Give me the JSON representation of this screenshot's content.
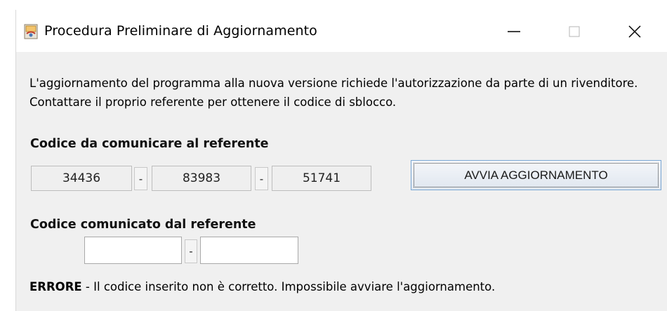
{
  "window": {
    "title": "Procedura Preliminare di Aggiornamento",
    "controls": {
      "minimize": "—",
      "maximize": "☐",
      "close": "✕"
    },
    "icon": "installer-app-icon"
  },
  "description": "L'aggiornamento del programma alla nuova versione richiede l'autorizzazione da parte di un rivenditore. Contattare il proprio referente per ottenere il codice di sblocco.",
  "section_code_to_send": {
    "heading": "Codice da comunicare al referente",
    "codes": [
      "34436",
      "83983",
      "51741"
    ],
    "separator": "-"
  },
  "start_button": {
    "label": "AVVIA AGGIORNAMENTO"
  },
  "section_code_received": {
    "heading": "Codice comunicato dal referente",
    "field1_value": "",
    "field2_value": "",
    "separator": "-"
  },
  "error": {
    "label": "ERRORE",
    "message": " - Il codice inserito non è corretto. Impossibile avviare l'aggiornamento."
  }
}
